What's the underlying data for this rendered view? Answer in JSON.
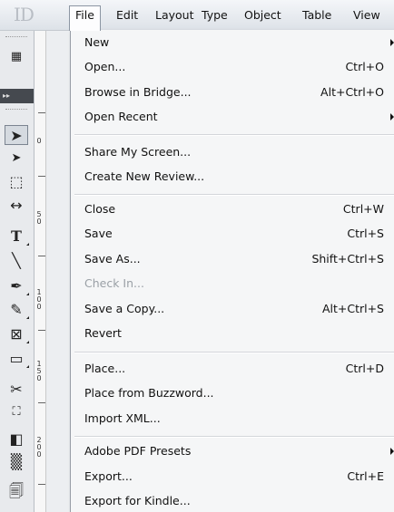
{
  "app": {
    "logo_text": "ID"
  },
  "menubar": {
    "items": [
      "File",
      "Edit",
      "Layout",
      "Type",
      "Object",
      "Table",
      "View"
    ],
    "active": "File"
  },
  "ruler": {
    "labels": [
      "0",
      "5\n0",
      "1\n0\n0",
      "1\n5\n0",
      "2\n0\n0"
    ]
  },
  "file_menu": {
    "groups": [
      [
        {
          "label": "New",
          "shortcut": "",
          "submenu": true
        },
        {
          "label": "Open...",
          "shortcut": "Ctrl+O"
        },
        {
          "label": "Browse in Bridge...",
          "shortcut": "Alt+Ctrl+O"
        },
        {
          "label": "Open Recent",
          "shortcut": "",
          "submenu": true
        }
      ],
      [
        {
          "label": "Share My Screen...",
          "shortcut": ""
        },
        {
          "label": "Create New Review...",
          "shortcut": ""
        }
      ],
      [
        {
          "label": "Close",
          "shortcut": "Ctrl+W"
        },
        {
          "label": "Save",
          "shortcut": "Ctrl+S"
        },
        {
          "label": "Save As...",
          "shortcut": "Shift+Ctrl+S"
        },
        {
          "label": "Check In...",
          "shortcut": "",
          "disabled": true
        },
        {
          "label": "Save a Copy...",
          "shortcut": "Alt+Ctrl+S"
        },
        {
          "label": "Revert",
          "shortcut": ""
        }
      ],
      [
        {
          "label": "Place...",
          "shortcut": "Ctrl+D"
        },
        {
          "label": "Place from Buzzword...",
          "shortcut": ""
        },
        {
          "label": "Import XML...",
          "shortcut": ""
        }
      ],
      [
        {
          "label": "Adobe PDF Presets",
          "shortcut": "",
          "submenu": true
        },
        {
          "label": "Export...",
          "shortcut": "Ctrl+E"
        },
        {
          "label": "Export for Kindle...",
          "shortcut": ""
        }
      ]
    ]
  }
}
